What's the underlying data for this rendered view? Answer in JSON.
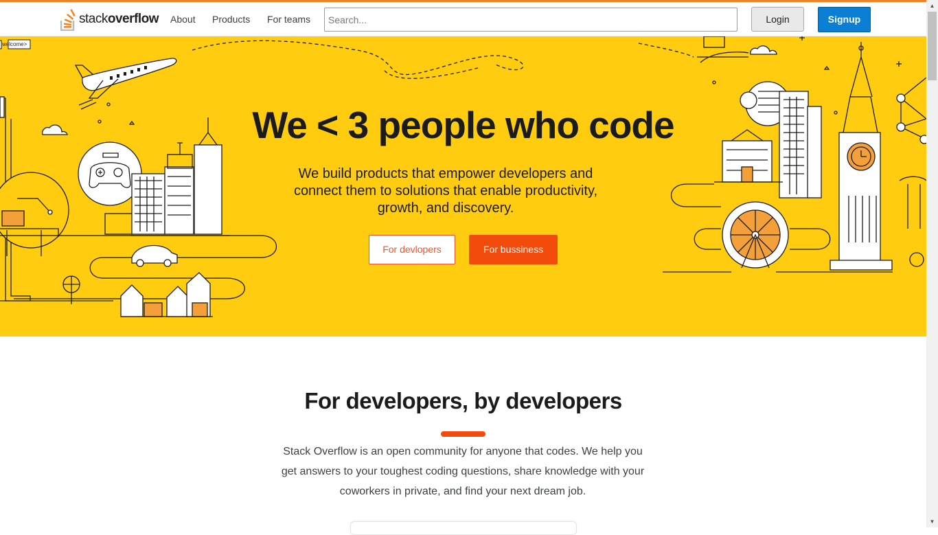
{
  "header": {
    "logo_light": "stack",
    "logo_bold": "overflow",
    "nav": [
      "About",
      "Products",
      "For teams"
    ],
    "search_placeholder": "Search...",
    "login_label": "Login",
    "signup_label": "Signup"
  },
  "hero": {
    "welcome_tag": "welcome>",
    "title": "We < 3 people who code",
    "subtitle": "We build products that empower developers and connect them to solutions that enable productivity, growth, and discovery.",
    "btn_developers": "For devlopers",
    "btn_business": "For bussiness"
  },
  "section": {
    "title": "For developers, by developers",
    "text": "Stack Overflow is an open community for anyone that codes. We help you get answers to your toughest coding questions, share knowledge with your coworkers in private, and find your next dream job."
  },
  "colors": {
    "brand_orange": "#f48024",
    "hero_yellow": "#ffcc10",
    "accent_red": "#f34b0b",
    "signup_blue": "#0a7fd4"
  }
}
